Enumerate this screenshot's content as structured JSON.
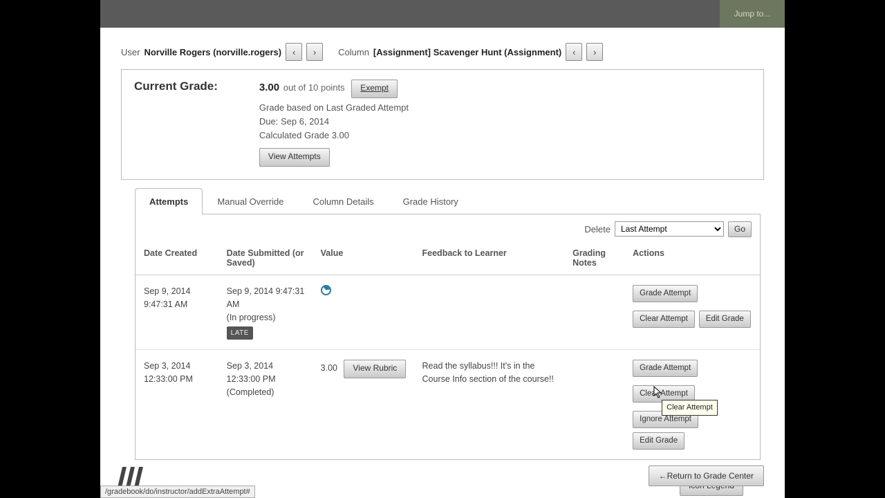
{
  "topbar": {
    "jump_to": "Jump to..."
  },
  "nav": {
    "user_label": "User",
    "user_value": "Norville Rogers (norville.rogers)",
    "column_label": "Column",
    "column_value": "[Assignment]  Scavenger Hunt (Assignment)"
  },
  "grade": {
    "label": "Current Grade:",
    "value": "3.00",
    "out_of": "out of 10 points",
    "exempt": "Exempt",
    "basis": "Grade based on Last Graded Attempt",
    "due": "Due: Sep 6, 2014",
    "calc": "Calculated Grade  3.00",
    "view_attempts": "View Attempts"
  },
  "tabs": {
    "attempts": "Attempts",
    "override": "Manual Override",
    "coldetails": "Column Details",
    "history": "Grade History"
  },
  "delete": {
    "label": "Delete",
    "selected": "Last Attempt",
    "go": "Go"
  },
  "columns": {
    "created": "Date Created",
    "submitted": "Date Submitted (or Saved)",
    "value": "Value",
    "feedback": "Feedback to Learner",
    "notes": "Grading Notes",
    "actions": "Actions"
  },
  "rows": [
    {
      "created": "Sep 9, 2014 9:47:31 AM",
      "submitted": "Sep 9, 2014 9:47:31 AM",
      "status": "(In progress)",
      "late": "LATE",
      "value": "",
      "feedback": "",
      "grade_attempt": "Grade Attempt",
      "clear_attempt": "Clear Attempt",
      "edit_grade": "Edit Grade"
    },
    {
      "created": "Sep 3, 2014 12:33:00 PM",
      "submitted": "Sep 3, 2014 12:33:00 PM",
      "status": "(Completed)",
      "value": "3.00",
      "view_rubric": "View Rubric",
      "feedback": "Read the syllabus!!!  It's in the Course Info section of the course!!",
      "grade_attempt": "Grade Attempt",
      "clear_attempt": "Clear Attempt",
      "ignore_attempt": "Ignore Attempt",
      "edit_grade": "Edit Grade"
    }
  ],
  "tooltip": "Clear Attempt",
  "icon_legend": "Icon Legend",
  "return": "←Return to Grade Center",
  "statusbar": "/gradebook/do/instructor/addExtraAttempt#"
}
